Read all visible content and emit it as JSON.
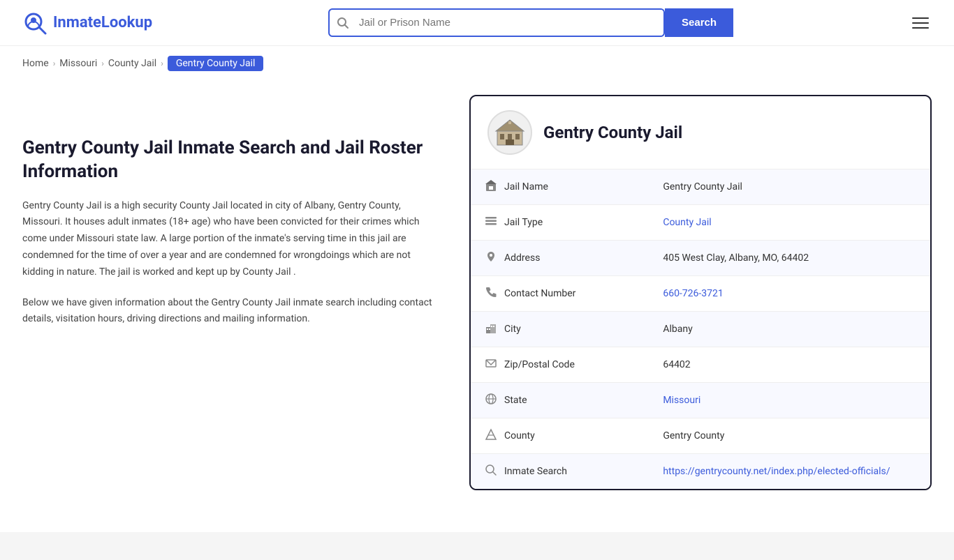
{
  "header": {
    "logo_brand": "InmateLookup",
    "logo_brand_part1": "Inmate",
    "logo_brand_part2": "Lookup",
    "search_placeholder": "Jail or Prison Name",
    "search_button_label": "Search"
  },
  "breadcrumb": {
    "home": "Home",
    "state": "Missouri",
    "type": "County Jail",
    "current": "Gentry County Jail"
  },
  "left": {
    "title": "Gentry County Jail Inmate Search and Jail Roster Information",
    "desc1": "Gentry County Jail is a high security County Jail located in city of Albany, Gentry County, Missouri. It houses adult inmates (18+ age) who have been convicted for their crimes which come under Missouri state law. A large portion of the inmate's serving time in this jail are condemned for the time of over a year and are condemned for wrongdoings which are not kidding in nature. The jail is worked and kept up by County Jail .",
    "desc2": "Below we have given information about the Gentry County Jail inmate search including contact details, visitation hours, driving directions and mailing information."
  },
  "card": {
    "title": "Gentry County Jail",
    "fields": [
      {
        "icon": "building-icon",
        "label": "Jail Name",
        "value": "Gentry County Jail",
        "link": null
      },
      {
        "icon": "list-icon",
        "label": "Jail Type",
        "value": "County Jail",
        "link": "#"
      },
      {
        "icon": "location-icon",
        "label": "Address",
        "value": "405 West Clay, Albany, MO, 64402",
        "link": null
      },
      {
        "icon": "phone-icon",
        "label": "Contact Number",
        "value": "660-726-3721",
        "link": "tel:660-726-3721"
      },
      {
        "icon": "city-icon",
        "label": "City",
        "value": "Albany",
        "link": null
      },
      {
        "icon": "mail-icon",
        "label": "Zip/Postal Code",
        "value": "64402",
        "link": null
      },
      {
        "icon": "globe-icon",
        "label": "State",
        "value": "Missouri",
        "link": "#"
      },
      {
        "icon": "county-icon",
        "label": "County",
        "value": "Gentry County",
        "link": null
      },
      {
        "icon": "search-icon",
        "label": "Inmate Search",
        "value": "https://gentrycounty.net/index.php/elected-officials/",
        "link": "https://gentrycounty.net/index.php/elected-officials/"
      }
    ]
  }
}
